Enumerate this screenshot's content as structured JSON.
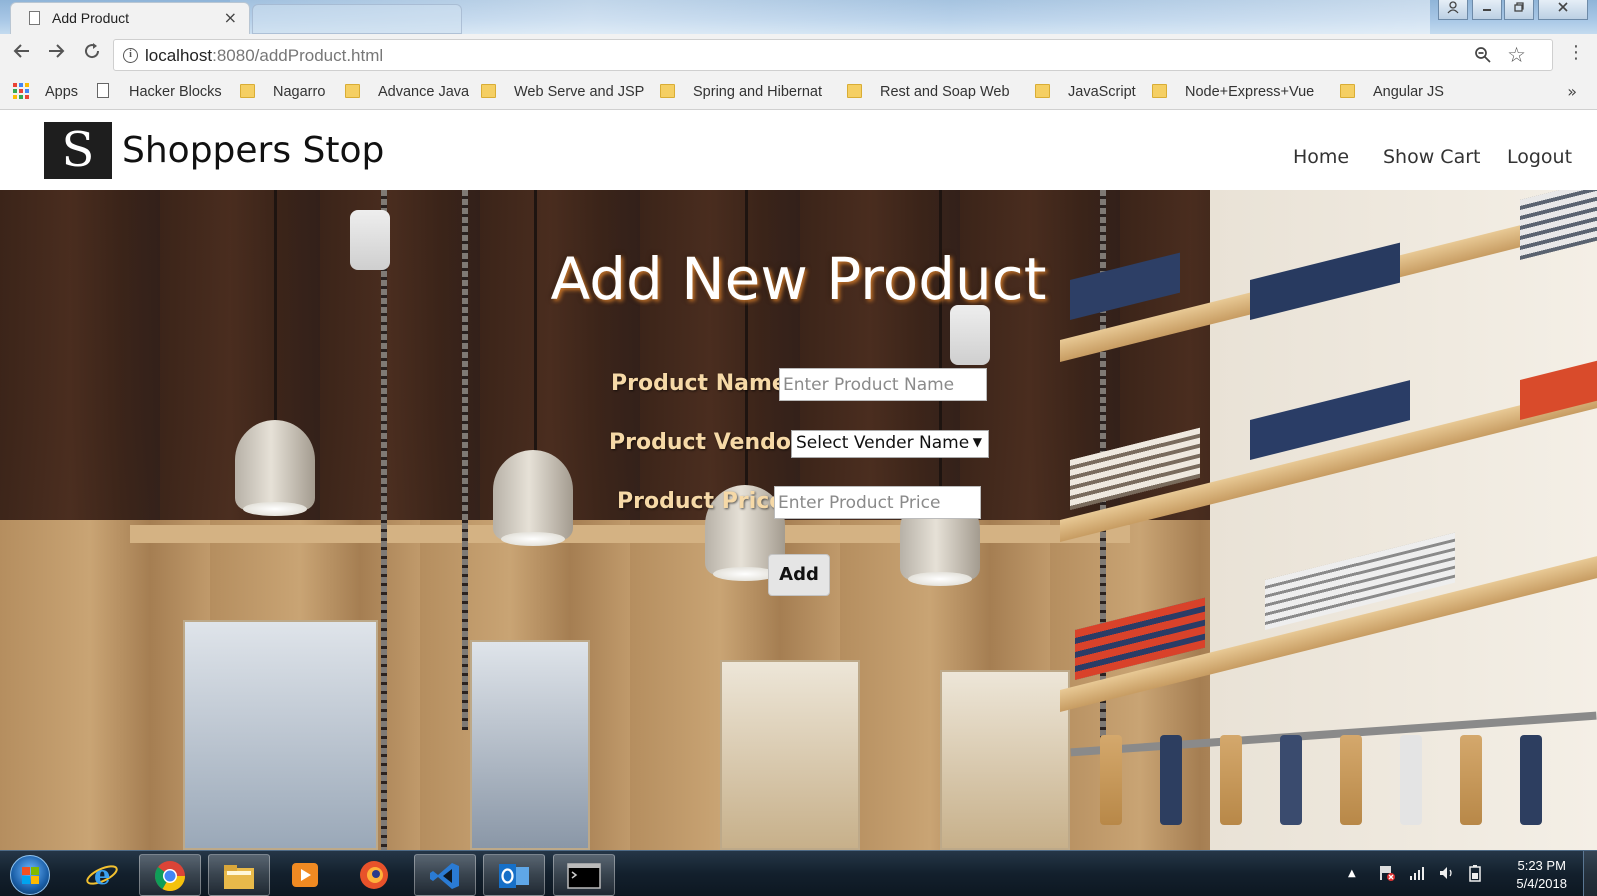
{
  "browser": {
    "tab_title": "Add Product",
    "tab_close": "×",
    "url_host": "localhost",
    "url_rest": ":8080/addProduct.html",
    "bookmarks": {
      "apps": "Apps",
      "items": [
        "Hacker Blocks",
        "Nagarro",
        "Advance Java",
        "Web Serve and JSP",
        "Spring and Hibernat",
        "Rest and Soap Web",
        "JavaScript",
        "Node+Express+Vue",
        "Angular JS"
      ],
      "more": "»"
    }
  },
  "site": {
    "logo_letter": "S",
    "brand": "Shoppers Stop",
    "nav": [
      "Home",
      "Show Cart",
      "Logout"
    ]
  },
  "form": {
    "title": "Add New Product",
    "name_label": "Product Name :",
    "name_placeholder": "Enter Product Name",
    "vendor_label": "Product Vendor :",
    "vendor_selected": "Select Vender Name",
    "price_label": "Product Price :",
    "price_placeholder": "Enter Product Price",
    "add_button": "Add"
  },
  "taskbar": {
    "time": "5:23 PM",
    "date": "5/4/2018"
  },
  "colors": {
    "label": "#f6d9a7",
    "title_glow": "#d27b2b",
    "brand_text": "#111111"
  }
}
